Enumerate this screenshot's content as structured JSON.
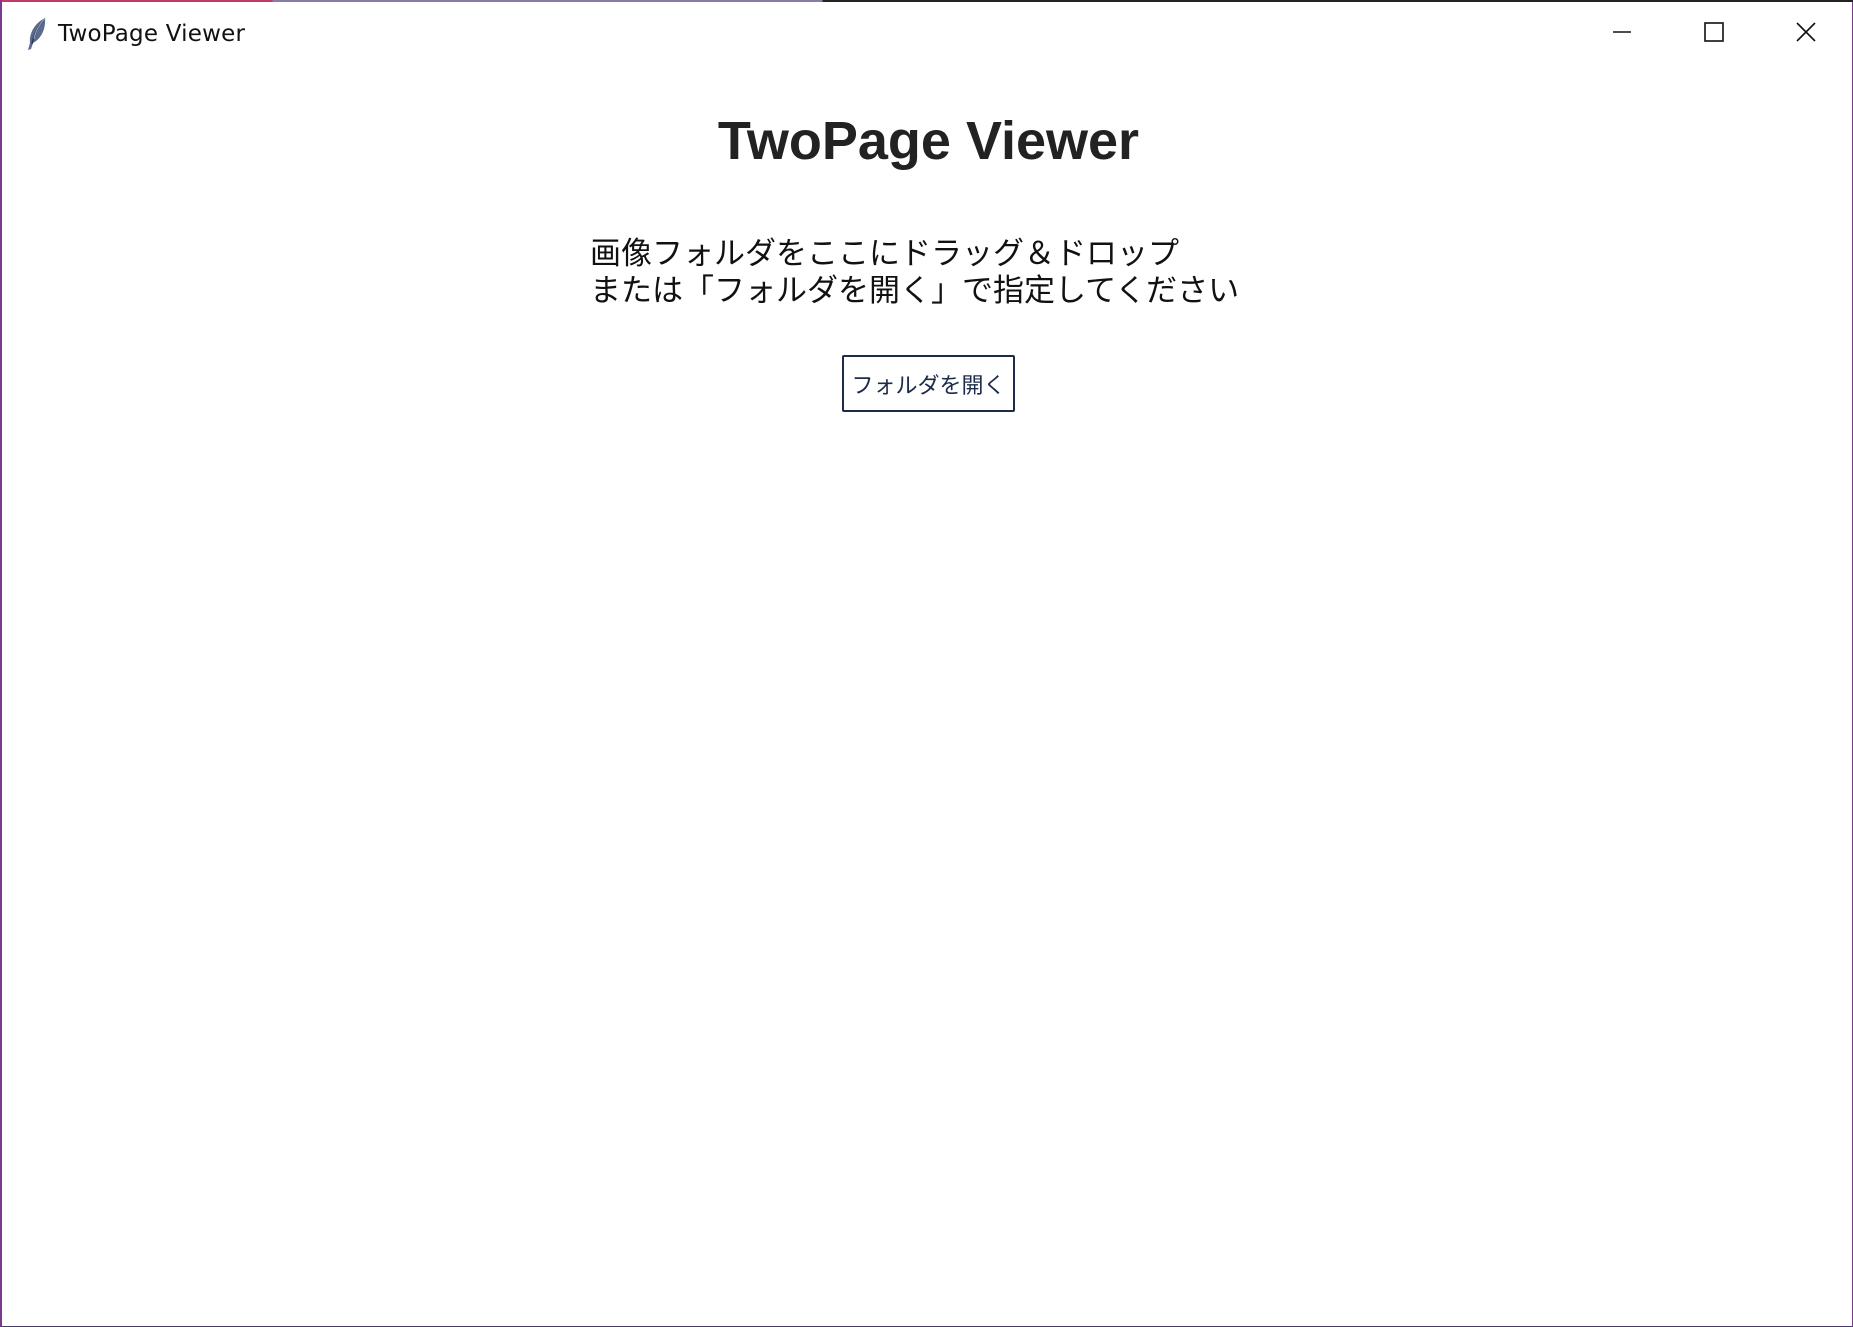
{
  "window": {
    "title": "TwoPage Viewer",
    "icon": "feather-icon",
    "controls": [
      "minimize-icon",
      "maximize-icon",
      "close-icon"
    ]
  },
  "main": {
    "heading": "TwoPage Viewer",
    "instructions_line1": "画像フォルダをここにドラッグ＆ドロップ",
    "instructions_line2": "または「フォルダを開く」で指定してください",
    "open_folder_label": "フォルダを開く"
  },
  "colors": {
    "background": "#ffffff",
    "heading_text": "#222222",
    "button_border": "#1c2b4a"
  }
}
